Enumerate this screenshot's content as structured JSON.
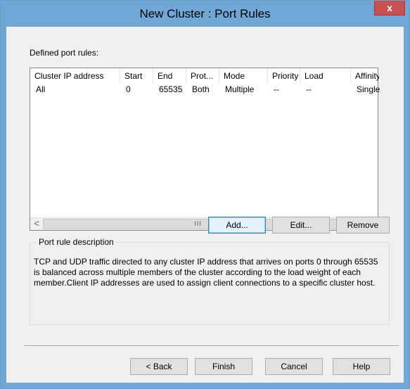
{
  "window": {
    "title": "New Cluster : Port Rules",
    "close_label": "x"
  },
  "port_rules": {
    "label": "Defined port rules:",
    "columns": [
      "Cluster IP address",
      "Start",
      "End",
      "Prot...",
      "Mode",
      "Priority",
      "Load",
      "Affinity"
    ],
    "rows": [
      [
        "All",
        "0",
        "65535",
        "Both",
        "Multiple",
        "--",
        "--",
        "Single"
      ]
    ],
    "scroll_left": "<",
    "scroll_right": ">",
    "scroll_thumb": "III"
  },
  "rule_buttons": {
    "add": "Add...",
    "edit": "Edit...",
    "remove": "Remove"
  },
  "description": {
    "legend": "Port rule description",
    "text": "TCP and UDP traffic directed to any cluster IP address that arrives on ports 0 through 65535 is balanced across multiple members of the cluster according to the load weight of each member.Client IP addresses are used to assign client connections to a specific cluster host."
  },
  "nav_buttons": {
    "back": "< Back",
    "finish": "Finish",
    "cancel": "Cancel",
    "help": "Help"
  }
}
